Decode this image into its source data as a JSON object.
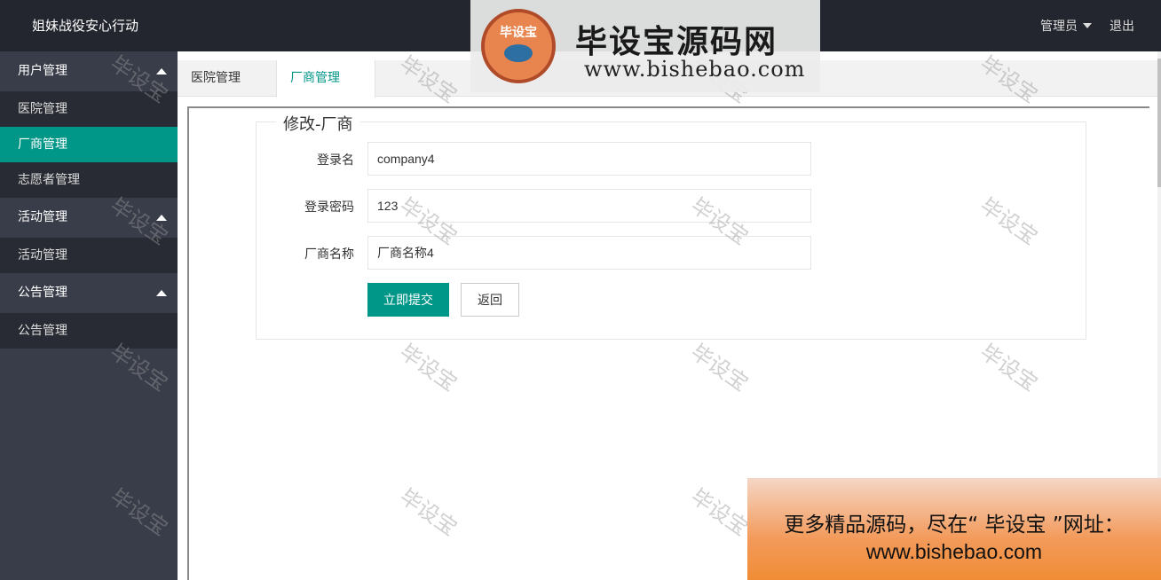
{
  "header": {
    "app_title": "姐妹战役安心行动",
    "user_label": "管理员",
    "logout_label": "退出"
  },
  "sidebar": {
    "groups": [
      {
        "label": "用户管理",
        "items": [
          {
            "label": "医院管理"
          },
          {
            "label": "厂商管理"
          },
          {
            "label": "志愿者管理"
          }
        ]
      },
      {
        "label": "活动管理",
        "items": [
          {
            "label": "活动管理"
          }
        ]
      },
      {
        "label": "公告管理",
        "items": [
          {
            "label": "公告管理"
          }
        ]
      }
    ]
  },
  "tabs": [
    {
      "label": "医院管理",
      "close": "✕"
    },
    {
      "label": "厂商管理",
      "close": "✕"
    }
  ],
  "form": {
    "legend": "修改-厂商",
    "fields": [
      {
        "label": "登录名",
        "value": "company4"
      },
      {
        "label": "登录密码",
        "value": "123"
      },
      {
        "label": "厂商名称",
        "value": "厂商名称4"
      }
    ],
    "submit_label": "立即提交",
    "back_label": "返回"
  },
  "watermark": {
    "text": "毕设宝"
  },
  "brand": {
    "seal_text": "毕设宝",
    "title": "毕设宝源码网",
    "url": "www.bishebao.com"
  },
  "promo": {
    "line1": "更多精品源码，尽在“ 毕设宝 ”网址：",
    "line2": "www.bishebao.com"
  }
}
